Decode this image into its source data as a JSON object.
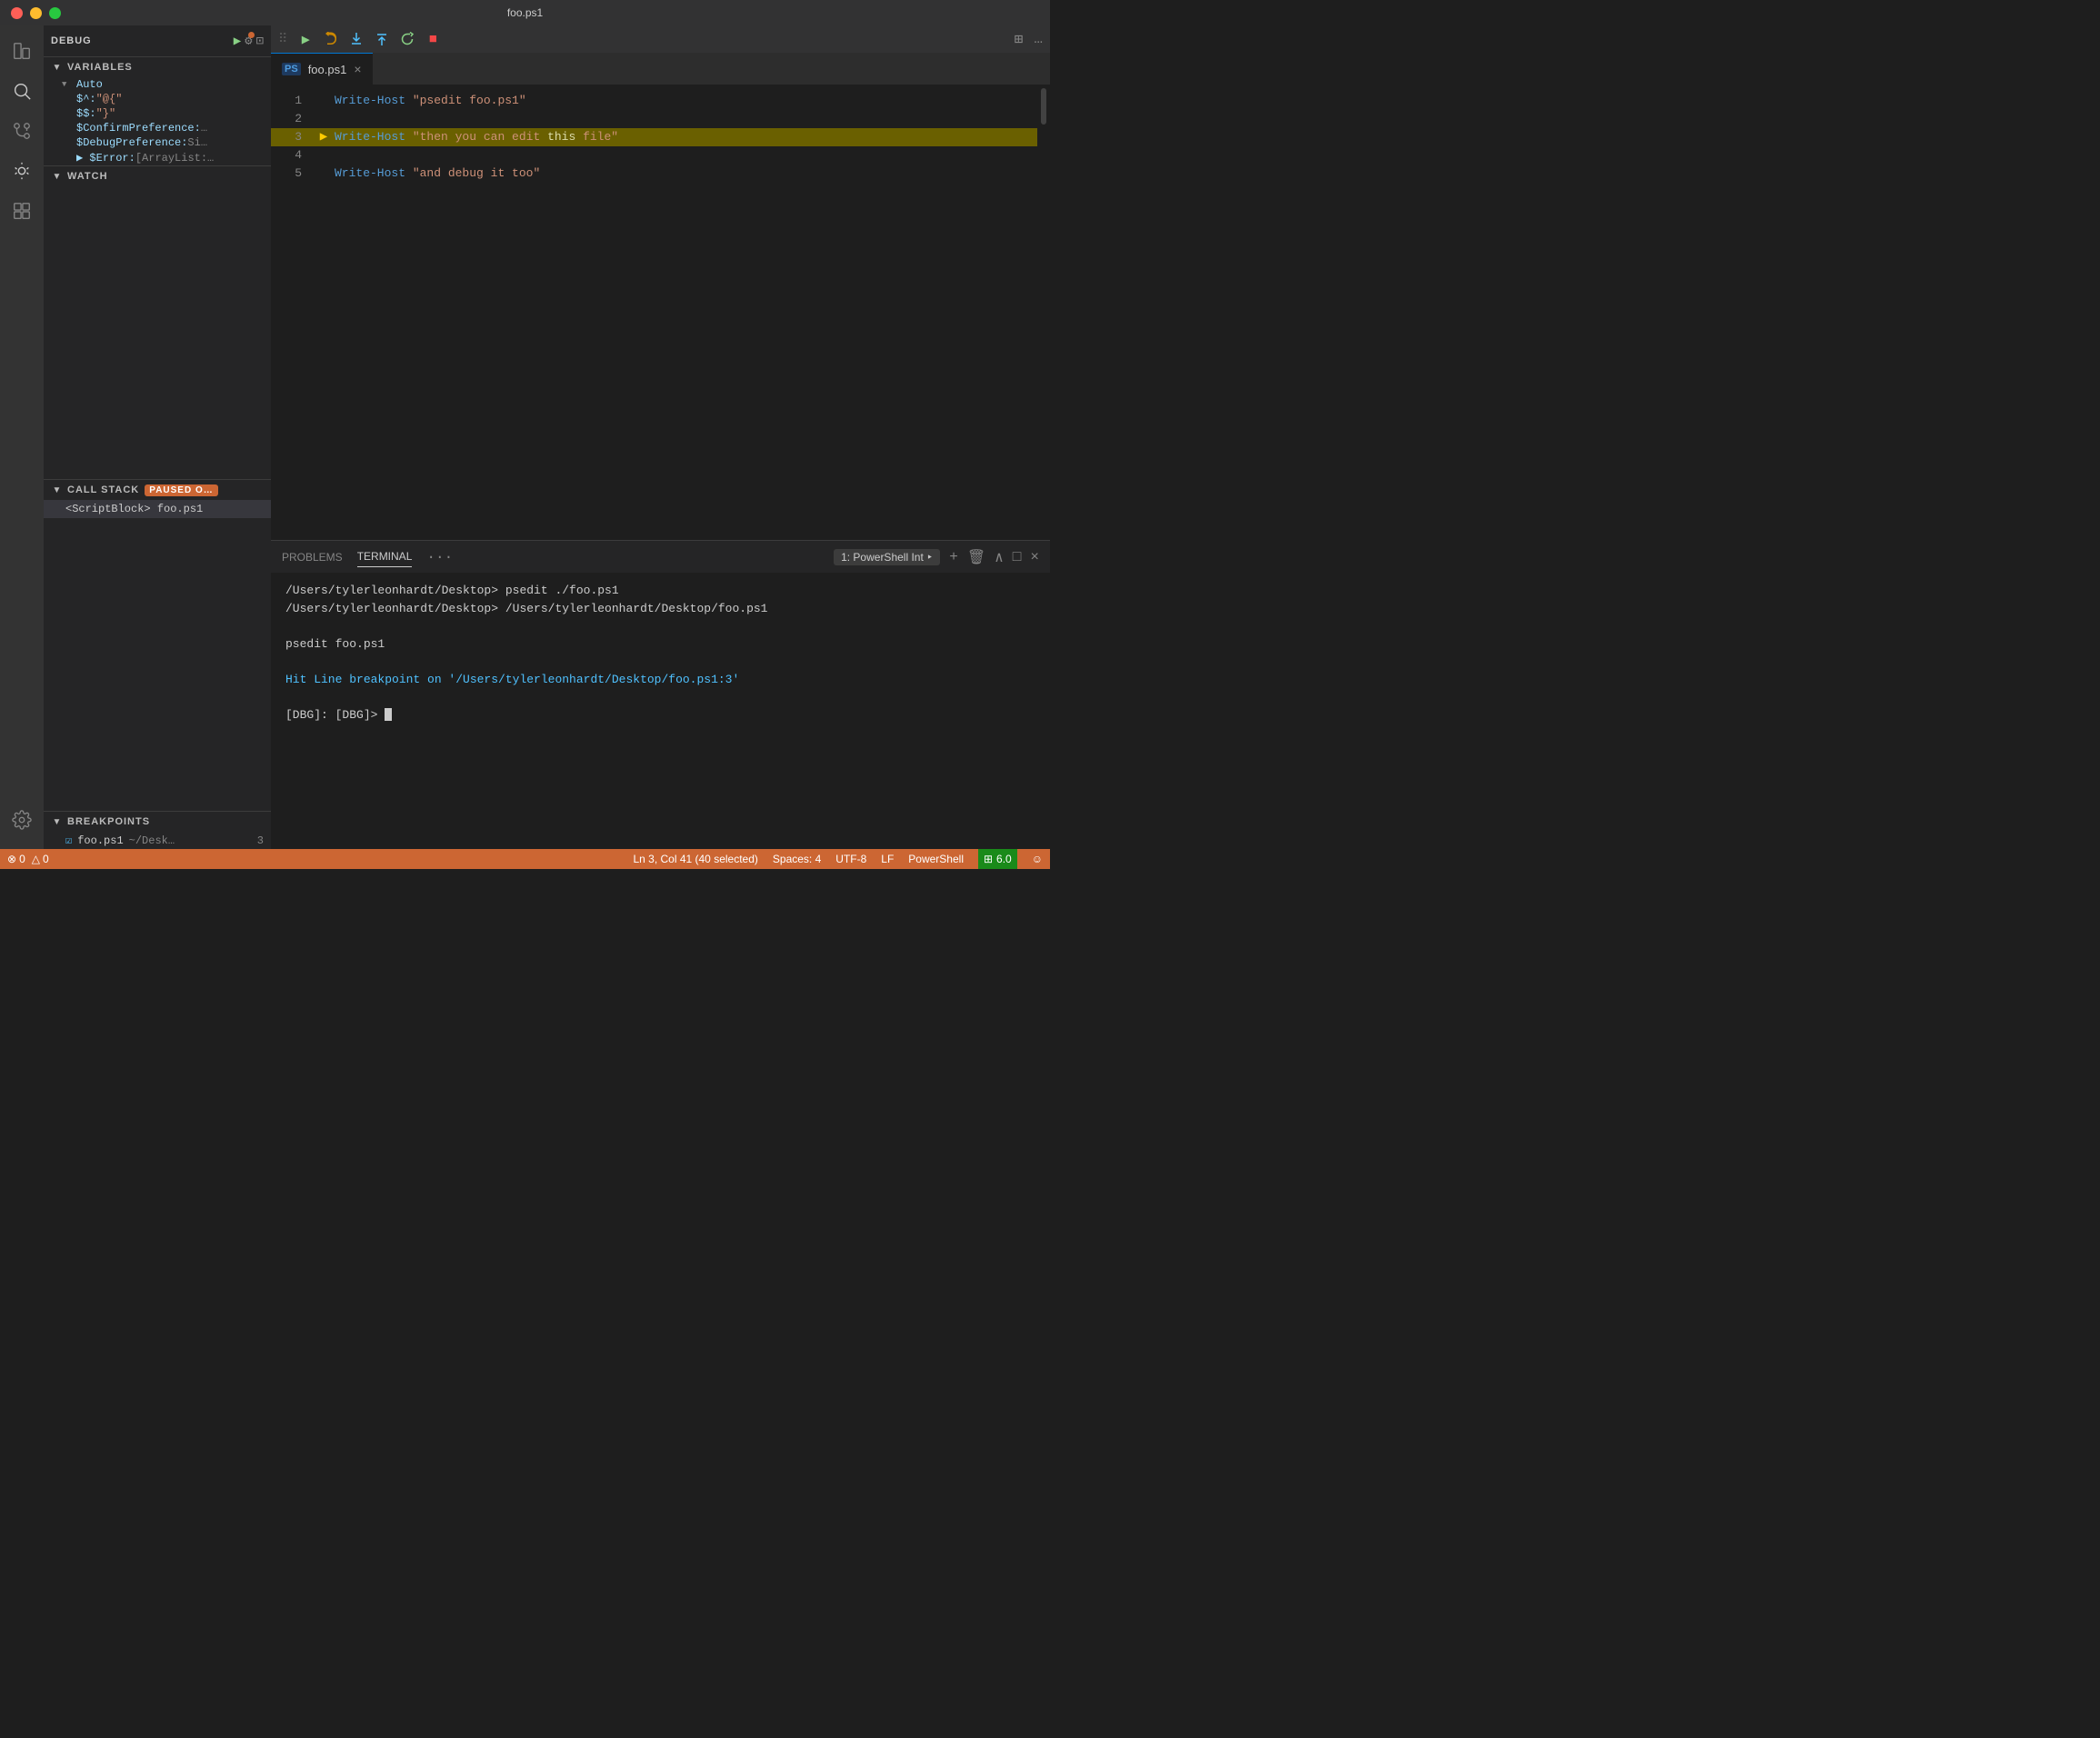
{
  "titlebar": {
    "title": "foo.ps1"
  },
  "debug_panel": {
    "label": "DEBUG",
    "play_label": "▶",
    "gear_label": "⚙",
    "terminal_label": "⊡"
  },
  "variables": {
    "header": "VARIABLES",
    "auto_header": "Auto",
    "items": [
      {
        "key": "$^:",
        "value": "\"@{\""
      },
      {
        "key": "$$:",
        "value": "\"}\""
      },
      {
        "key": "$ConfirmPreference:",
        "value": "…"
      },
      {
        "key": "$DebugPreference:",
        "value": "Si…"
      },
      {
        "key": "$Error:",
        "value": "[ArrayList:…"
      }
    ]
  },
  "watch": {
    "header": "WATCH"
  },
  "callstack": {
    "header": "CALL STACK",
    "badge": "PAUSED O…",
    "item": "<ScriptBlock>  foo.ps1"
  },
  "breakpoints": {
    "header": "BREAKPOINTS",
    "items": [
      {
        "checked": true,
        "file": "foo.ps1",
        "path": "~/Desk…",
        "line": "3"
      }
    ]
  },
  "toolbar": {
    "buttons": [
      {
        "id": "continue",
        "symbol": "▶",
        "class": "play",
        "label": "Continue"
      },
      {
        "id": "step-over",
        "symbol": "↺",
        "class": "orange",
        "label": "Step Over"
      },
      {
        "id": "step-into",
        "symbol": "↓",
        "class": "blue",
        "label": "Step Into"
      },
      {
        "id": "step-out",
        "symbol": "↑",
        "class": "blue",
        "label": "Step Out"
      },
      {
        "id": "restart",
        "symbol": "↻",
        "class": "green",
        "label": "Restart"
      },
      {
        "id": "stop",
        "symbol": "■",
        "class": "red",
        "label": "Stop"
      }
    ]
  },
  "tabs": [
    {
      "id": "foo-ps1",
      "icon": "PS",
      "label": "foo.ps1",
      "active": true,
      "closeable": true
    }
  ],
  "editor": {
    "lines": [
      {
        "num": "1",
        "content": "Write-Host \"psedit foo.ps1\"",
        "highlighted": false,
        "breakpoint": false,
        "current": false
      },
      {
        "num": "2",
        "content": "",
        "highlighted": false,
        "breakpoint": false,
        "current": false
      },
      {
        "num": "3",
        "content": "Write-Host \"then you can edit this file\"",
        "highlighted": true,
        "breakpoint": true,
        "current": true
      },
      {
        "num": "4",
        "content": "",
        "highlighted": false,
        "breakpoint": false,
        "current": false
      },
      {
        "num": "5",
        "content": "Write-Host \"and debug it too\"",
        "highlighted": false,
        "breakpoint": false,
        "current": false
      }
    ]
  },
  "terminal": {
    "tabs": [
      {
        "id": "problems",
        "label": "PROBLEMS",
        "active": false
      },
      {
        "id": "terminal",
        "label": "TERMINAL",
        "active": true
      }
    ],
    "dropdown": "1: PowerShell Int ‣",
    "lines": [
      {
        "text": "/Users/tylerleonhardt/Desktop> psedit ./foo.ps1",
        "color": "normal"
      },
      {
        "text": "/Users/tylerleonhardt/Desktop> /Users/tylerleonhardt/Desktop/foo.ps1",
        "color": "normal"
      },
      {
        "text": "",
        "color": "normal"
      },
      {
        "text": "psedit foo.ps1",
        "color": "normal"
      },
      {
        "text": "",
        "color": "normal"
      },
      {
        "text": "Hit Line breakpoint on '/Users/tylerleonhardt/Desktop/foo.ps1:3'",
        "color": "blue"
      },
      {
        "text": "",
        "color": "normal"
      },
      {
        "text": "[DBG]:  [DBG]> ",
        "color": "normal",
        "cursor": true
      }
    ]
  },
  "statusbar": {
    "errors": "0",
    "warnings": "0",
    "position": "Ln 3, Col 41 (40 selected)",
    "spaces": "Spaces: 4",
    "encoding": "UTF-8",
    "eol": "LF",
    "language": "PowerShell",
    "extension": "⊞ 6.0",
    "smiley": "☺"
  }
}
